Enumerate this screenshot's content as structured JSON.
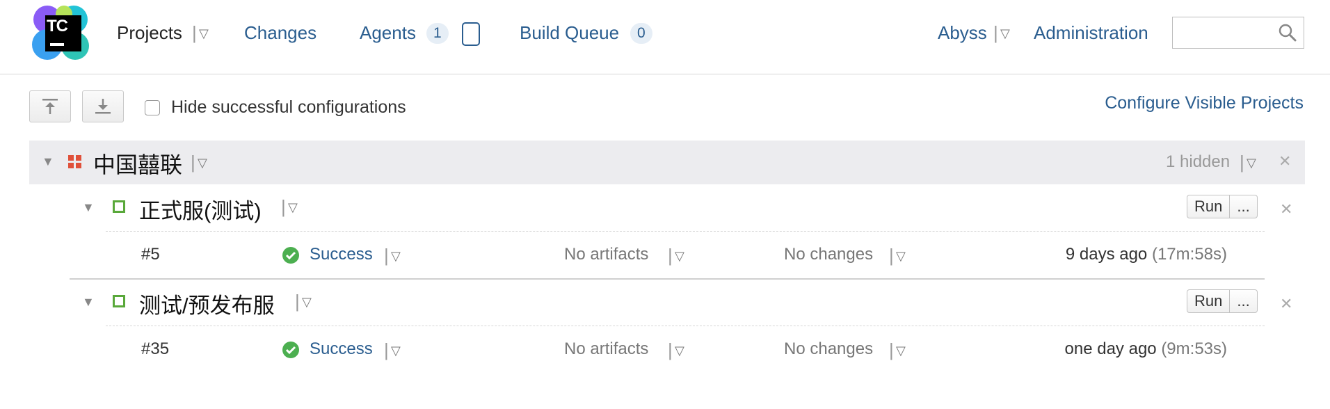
{
  "header": {
    "logo_text": "TC",
    "nav": {
      "projects": "Projects",
      "changes": "Changes",
      "agents": "Agents",
      "agents_count": "1",
      "build_queue": "Build Queue",
      "build_queue_count": "0",
      "user": "Abyss",
      "administration": "Administration"
    },
    "search": {
      "value": "",
      "placeholder": ""
    }
  },
  "toolbar": {
    "hide_successful_label": "Hide successful configurations",
    "hide_successful_checked": false,
    "configure_link": "Configure Visible Projects"
  },
  "project": {
    "name": "中国囍联",
    "hidden_text": "1 hidden",
    "configurations": [
      {
        "name": "正式服(测试)",
        "run_label": "Run",
        "more_label": "...",
        "build": {
          "number": "#5",
          "status": "Success",
          "artifacts": "No artifacts",
          "changes": "No changes",
          "time": "9 days ago",
          "duration": "(17m:58s)"
        }
      },
      {
        "name": "测试/预发布服",
        "run_label": "Run",
        "more_label": "...",
        "build": {
          "number": "#35",
          "status": "Success",
          "artifacts": "No artifacts",
          "changes": "No changes",
          "time": "one day ago",
          "duration": "(9m:53s)"
        }
      }
    ]
  },
  "colors": {
    "link": "#2a5d8f",
    "success": "#4caf50",
    "project_band": "#ececef",
    "project_icon": "#e0503a",
    "config_icon": "#59a83a"
  },
  "icons": [
    "teamcity-logo",
    "chevron-down-icon",
    "collapse-all-icon",
    "expand-all-icon",
    "search-icon",
    "success-check-icon",
    "close-icon",
    "project-icon",
    "build-config-icon"
  ]
}
